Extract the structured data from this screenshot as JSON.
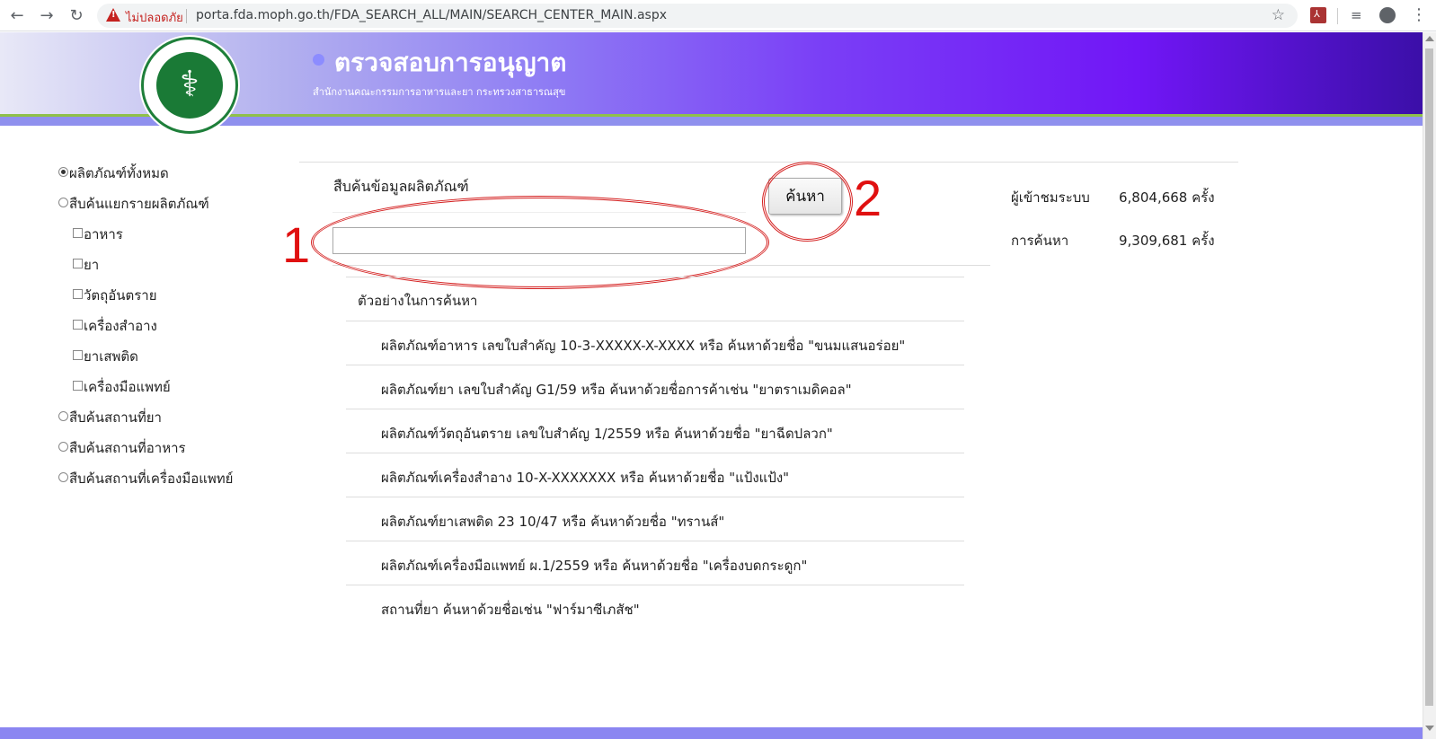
{
  "browser": {
    "security_label": "ไม่ปลอดภัย",
    "url": "porta.fda.moph.go.th/FDA_SEARCH_ALL/MAIN/SEARCH_CENTER_MAIN.aspx"
  },
  "header": {
    "title": "ตรวจสอบการอนุญาต",
    "subtitle": "สำนักงานคณะกรรมการอาหารและยา กระทรวงสาธารณสุข"
  },
  "sidebar": {
    "items": [
      {
        "label": "ผลิตภัณฑ์ทั้งหมด",
        "type": "radio",
        "checked": true
      },
      {
        "label": "สืบค้นแยกรายผลิตภัณฑ์",
        "type": "radio",
        "checked": false
      },
      {
        "label": "อาหาร",
        "type": "checkbox",
        "checked": false
      },
      {
        "label": "ยา",
        "type": "checkbox",
        "checked": false
      },
      {
        "label": "วัตถุอันตราย",
        "type": "checkbox",
        "checked": false
      },
      {
        "label": "เครื่องสำอาง",
        "type": "checkbox",
        "checked": false
      },
      {
        "label": "ยาเสพติด",
        "type": "checkbox",
        "checked": false
      },
      {
        "label": "เครื่องมือแพทย์",
        "type": "checkbox",
        "checked": false
      },
      {
        "label": "สืบค้นสถานที่ยา",
        "type": "radio",
        "checked": false
      },
      {
        "label": "สืบค้นสถานที่อาหาร",
        "type": "radio",
        "checked": false
      },
      {
        "label": "สืบค้นสถานที่เครื่องมือแพทย์",
        "type": "radio",
        "checked": false
      }
    ]
  },
  "search": {
    "label": "สืบค้นข้อมูลผลิตภัณฑ์",
    "value": "",
    "button_label": "ค้นหา"
  },
  "annotations": {
    "input_number": "1",
    "button_number": "2",
    "color": "#d42020"
  },
  "examples": {
    "title": "ตัวอย่างในการค้นหา",
    "items": [
      "ผลิตภัณฑ์อาหาร เลขใบสำคัญ 10-3-XXXXX-X-XXXX หรือ ค้นหาด้วยชื่อ  \"ขนมแสนอร่อย\"",
      "ผลิตภัณฑ์ยา เลขใบสำคัญ G1/59 หรือ ค้นหาด้วยชื่อการค้าเช่น \"ยาตราเมดิคอล\"",
      "ผลิตภัณฑ์วัตถุอันตราย เลขใบสำคัญ 1/2559 หรือ ค้นหาด้วยชื่อ \"ยาฉีดปลวก\"",
      "ผลิตภัณฑ์เครื่องสำอาง 10-X-XXXXXXX หรือ ค้นหาด้วยชื่อ \"แป้งแป้ง\"",
      "ผลิตภัณฑ์ยาเสพติด 23 10/47 หรือ ค้นหาด้วยชื่อ \"ทรานส์\"",
      "ผลิตภัณฑ์เครื่องมือแพทย์ ผ.1/2559 หรือ ค้นหาด้วยชื่อ \"เครื่องบดกระดูก\"",
      "สถานที่ยา ค้นหาด้วยชื่อเช่น \"ฟาร์มาซีเภสัช\""
    ]
  },
  "stats": {
    "visitors_label": "ผู้เข้าชมระบบ",
    "visitors_value": "6,804,668 ครั้ง",
    "searches_label": "การค้นหา",
    "searches_value": "9,309,681 ครั้ง"
  }
}
